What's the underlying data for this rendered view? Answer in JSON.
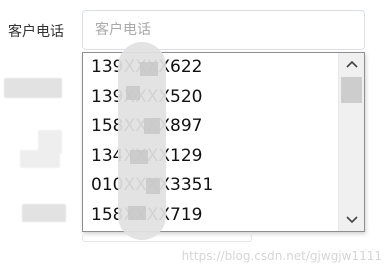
{
  "form": {
    "phone_label": "客户电话",
    "phone_placeholder": "客户电话"
  },
  "dropdown": {
    "options": [
      "139XXXX622",
      "139XXXX520",
      "158XXXX897",
      "134XXXX129",
      "010XXXX3351",
      "158XXXX719"
    ],
    "scroll_up_icon": "chevron-up-icon",
    "scroll_down_icon": "chevron-down-icon"
  },
  "watermark": "https://blog.csdn.net/gjwgjw1111"
}
